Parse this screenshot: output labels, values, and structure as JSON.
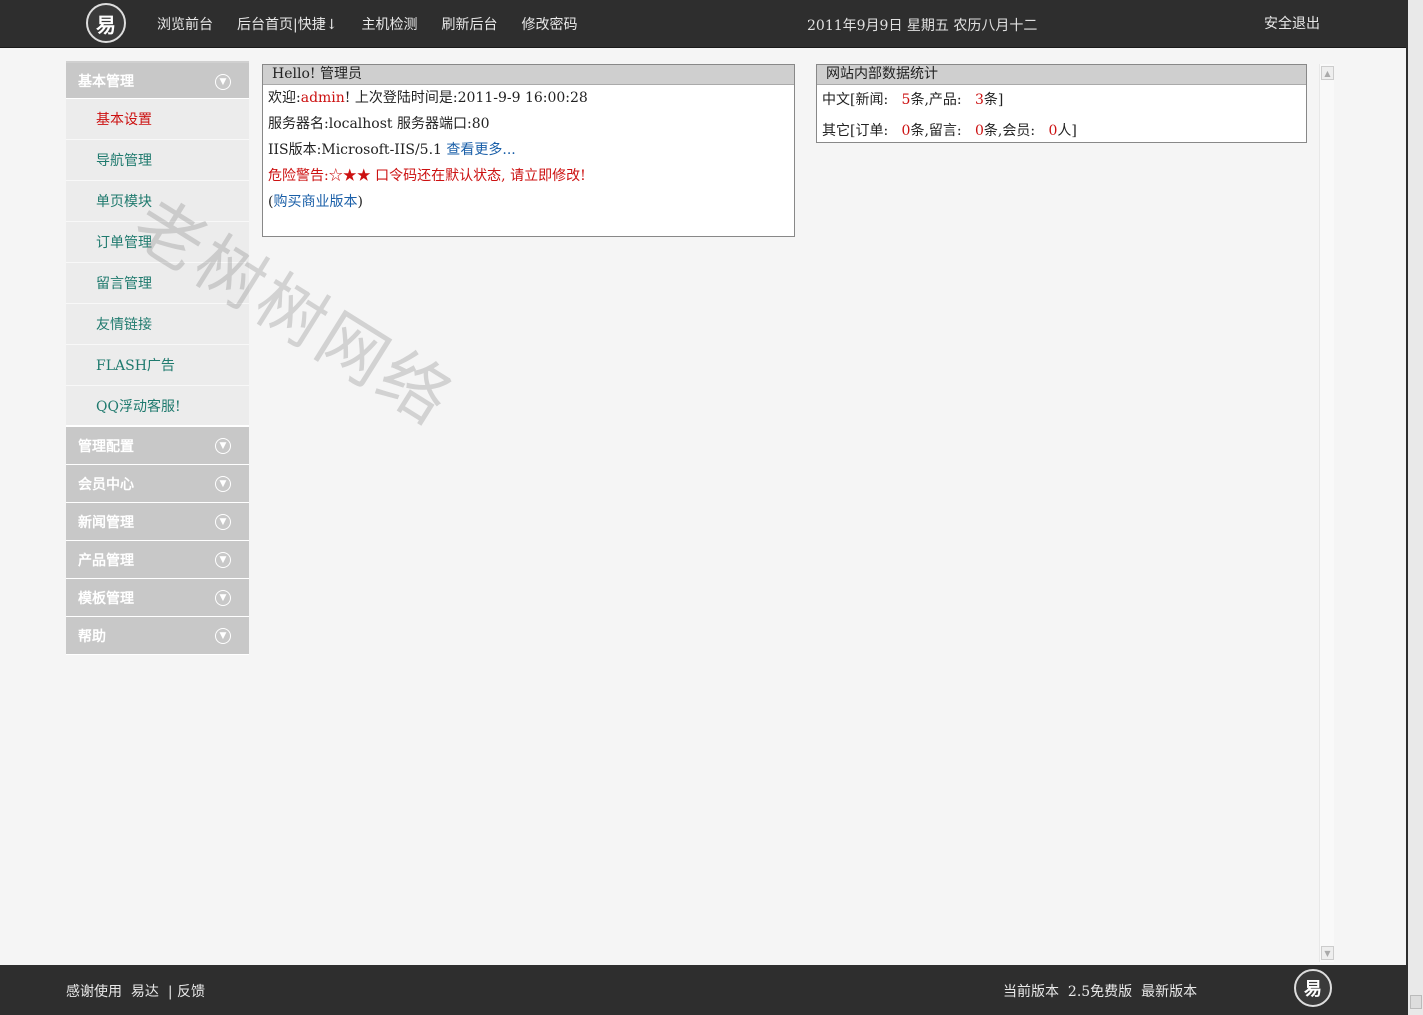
{
  "topbar": {
    "logo_icon": "eda-logo-icon",
    "nav": [
      "浏览前台",
      "后台首页|快捷↓",
      "主机检测",
      "刷新后台",
      "修改密码"
    ],
    "date": "2011年9月9日 星期五  农历八月十二",
    "logout": "安全退出"
  },
  "sidebar": {
    "groups": [
      {
        "title": "基本管理",
        "expanded": true,
        "items": [
          "基本设置",
          "导航管理",
          "单页模块",
          "订单管理",
          "留言管理",
          "友情链接",
          "FLASH广告",
          "QQ浮动客服!"
        ],
        "active_item": "基本设置"
      },
      {
        "title": "管理配置"
      },
      {
        "title": "会员中心"
      },
      {
        "title": "新闻管理"
      },
      {
        "title": "产品管理"
      },
      {
        "title": "模板管理"
      },
      {
        "title": "帮助"
      }
    ],
    "chevron_icon": "chevron-down-circle-icon"
  },
  "hello_panel": {
    "title": "Hello! 管理员",
    "welcome_label": "欢迎:",
    "username": "admin",
    "last_login_label": "! 上次登陆时间是:",
    "last_login_time": "2011-9-9 16:00:28",
    "server_line": "服务器名:localhost 服务器端口:80",
    "iis_line": "IIS版本:Microsoft-IIS/5.1",
    "see_more": "查看更多...",
    "warning": "危险警告:☆★★ 口令码还在默认状态, 请立即修改!",
    "buy_open": "(",
    "buy_link": "购买商业版本",
    "buy_close": ")"
  },
  "stats_panel": {
    "title": "网站内部数据统计",
    "row1_label": "中文[新闻:",
    "news_count": "5",
    "row1_mid": "条,产品:",
    "product_count": "3",
    "row1_end": "条]",
    "row2_label": "其它[订单:",
    "order_count": "0",
    "row2_mid1": "条,留言:",
    "message_count": "0",
    "row2_mid2": "条,会员:",
    "member_count": "0",
    "row2_end": "人]"
  },
  "watermark": "老树树网络",
  "footer": {
    "thanks": "感谢使用",
    "brand_link": "易达",
    "separator": "|",
    "feedback": "反馈",
    "version_label": "当前版本",
    "version": "2.5免费版",
    "latest": "最新版本"
  }
}
